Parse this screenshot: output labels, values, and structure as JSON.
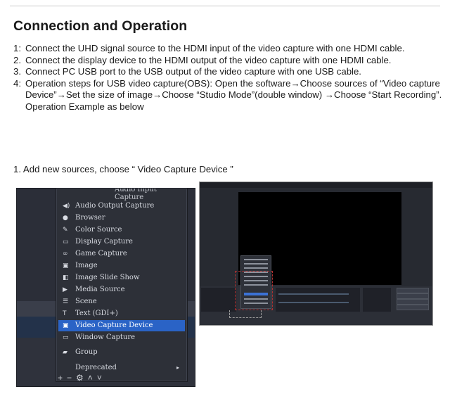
{
  "heading": "Connection and Operation",
  "steps": [
    {
      "num": "1:",
      "text": "Connect the UHD signal source to the HDMI input of the video capture with one HDMI cable."
    },
    {
      "num": "2.",
      "text": "Connect the display device to the HDMI output of the video capture with one HDMI cable."
    },
    {
      "num": "3.",
      "text": "Connect PC USB port to the USB output of the video capture with one USB cable."
    },
    {
      "num": "4:",
      "text": "Operation steps for USB video capture(OBS): Open the software→Choose sources of “Video capture Device”→Set the size of image→Choose “Studio Mode”(double window) →Choose “Start Recording”."
    }
  ],
  "example_note": "Operation Example as below",
  "sub_heading": "1. Add new sources, choose “ Video Capture Device ”",
  "menu": {
    "cut_item": "Audio Input Capture",
    "items": [
      {
        "label": "Audio Output Capture",
        "icon": "speaker-icon"
      },
      {
        "label": "Browser",
        "icon": "globe-icon"
      },
      {
        "label": "Color Source",
        "icon": "paint-brush-icon"
      },
      {
        "label": "Display Capture",
        "icon": "monitor-icon"
      },
      {
        "label": "Game Capture",
        "icon": "gamepad-icon"
      },
      {
        "label": "Image",
        "icon": "image-icon"
      },
      {
        "label": "Image Slide Show",
        "icon": "slideshow-icon"
      },
      {
        "label": "Media Source",
        "icon": "play-icon"
      },
      {
        "label": "Scene",
        "icon": "list-icon"
      },
      {
        "label": "Text (GDI+)",
        "icon": "text-icon"
      },
      {
        "label": "Video Capture Device",
        "icon": "camera-icon",
        "selected": true
      },
      {
        "label": "Window Capture",
        "icon": "window-icon"
      },
      {
        "label": "Group",
        "icon": "folder-icon"
      },
      {
        "label": "Deprecated",
        "icon": "",
        "submenu": true
      }
    ]
  },
  "colors": {
    "menu_bg": "#2d3038",
    "selected": "#2a63c6",
    "obs_bg": "#272a31",
    "accent_dash": "#b03030"
  }
}
